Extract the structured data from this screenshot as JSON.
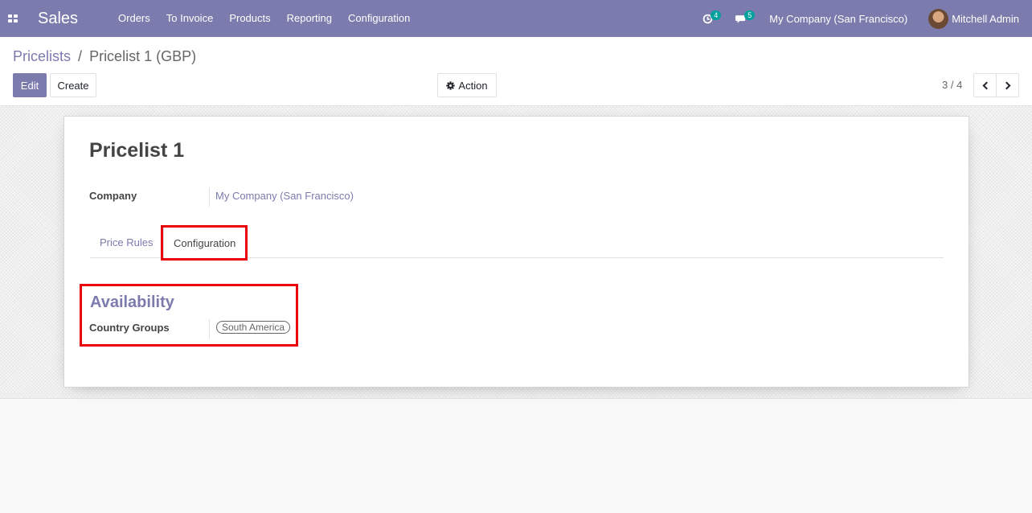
{
  "navbar": {
    "app_name": "Sales",
    "menu": [
      "Orders",
      "To Invoice",
      "Products",
      "Reporting",
      "Configuration"
    ],
    "activity_count": "4",
    "messages_count": "5",
    "company": "My Company (San Francisco)",
    "user": "Mitchell Admin",
    "accent_color": "#7c7bad"
  },
  "breadcrumb": {
    "parent": "Pricelists",
    "separator": "/",
    "current": "Pricelist 1 (GBP)"
  },
  "buttons": {
    "edit": "Edit",
    "create": "Create",
    "action": "Action"
  },
  "pager": {
    "value": "3 / 4"
  },
  "form": {
    "title": "Pricelist 1",
    "company_label": "Company",
    "company_value": "My Company (San Francisco)",
    "tabs": [
      "Price Rules",
      "Configuration"
    ],
    "active_tab": "Configuration",
    "availability_title": "Availability",
    "country_groups_label": "Country Groups",
    "country_groups_tags": [
      "South America"
    ]
  },
  "icons": {
    "apps": "apps-grid-icon",
    "activity": "clock-icon",
    "messages": "chat-bubble-icon",
    "action": "gear-icon",
    "pager_prev": "chevron-left-icon",
    "pager_next": "chevron-right-icon"
  },
  "highlight_color": "#e8000b"
}
